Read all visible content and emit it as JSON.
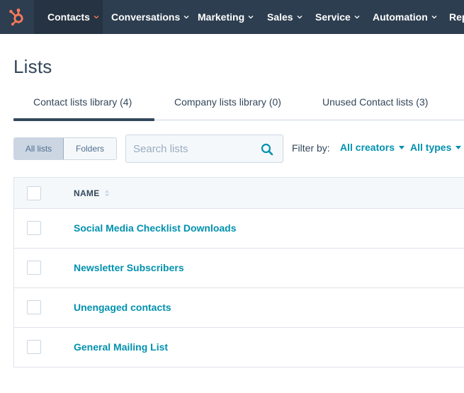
{
  "colors": {
    "nav_bg": "#2d3e50",
    "nav_active": "#253342",
    "brand_orange": "#ff7a59",
    "link": "#0091ae",
    "text": "#33475b"
  },
  "nav": {
    "logo_icon": "hubspot-sprocket-icon",
    "items": [
      {
        "label": "Contacts",
        "active": true
      },
      {
        "label": "Conversations"
      },
      {
        "label": "Marketing"
      },
      {
        "label": "Sales"
      },
      {
        "label": "Service"
      },
      {
        "label": "Automation"
      },
      {
        "label": "Rep"
      }
    ]
  },
  "page": {
    "title": "Lists"
  },
  "tabs": [
    {
      "label": "Contact lists library (4)",
      "active": true
    },
    {
      "label": "Company lists library (0)"
    },
    {
      "label": "Unused Contact lists (3)"
    }
  ],
  "toolbar": {
    "view_toggle": [
      {
        "label": "All lists",
        "active": true
      },
      {
        "label": "Folders"
      }
    ],
    "search": {
      "placeholder": "Search lists",
      "value": "",
      "icon": "search-icon"
    },
    "filter_label": "Filter by:",
    "creators_dropdown": "All creators",
    "types_dropdown": "All types"
  },
  "table": {
    "columns": [
      {
        "label": "NAME",
        "sortable": true
      }
    ],
    "rows": [
      {
        "name": "Social Media Checklist Downloads"
      },
      {
        "name": "Newsletter Subscribers"
      },
      {
        "name": "Unengaged contacts"
      },
      {
        "name": "General Mailing List"
      }
    ]
  }
}
